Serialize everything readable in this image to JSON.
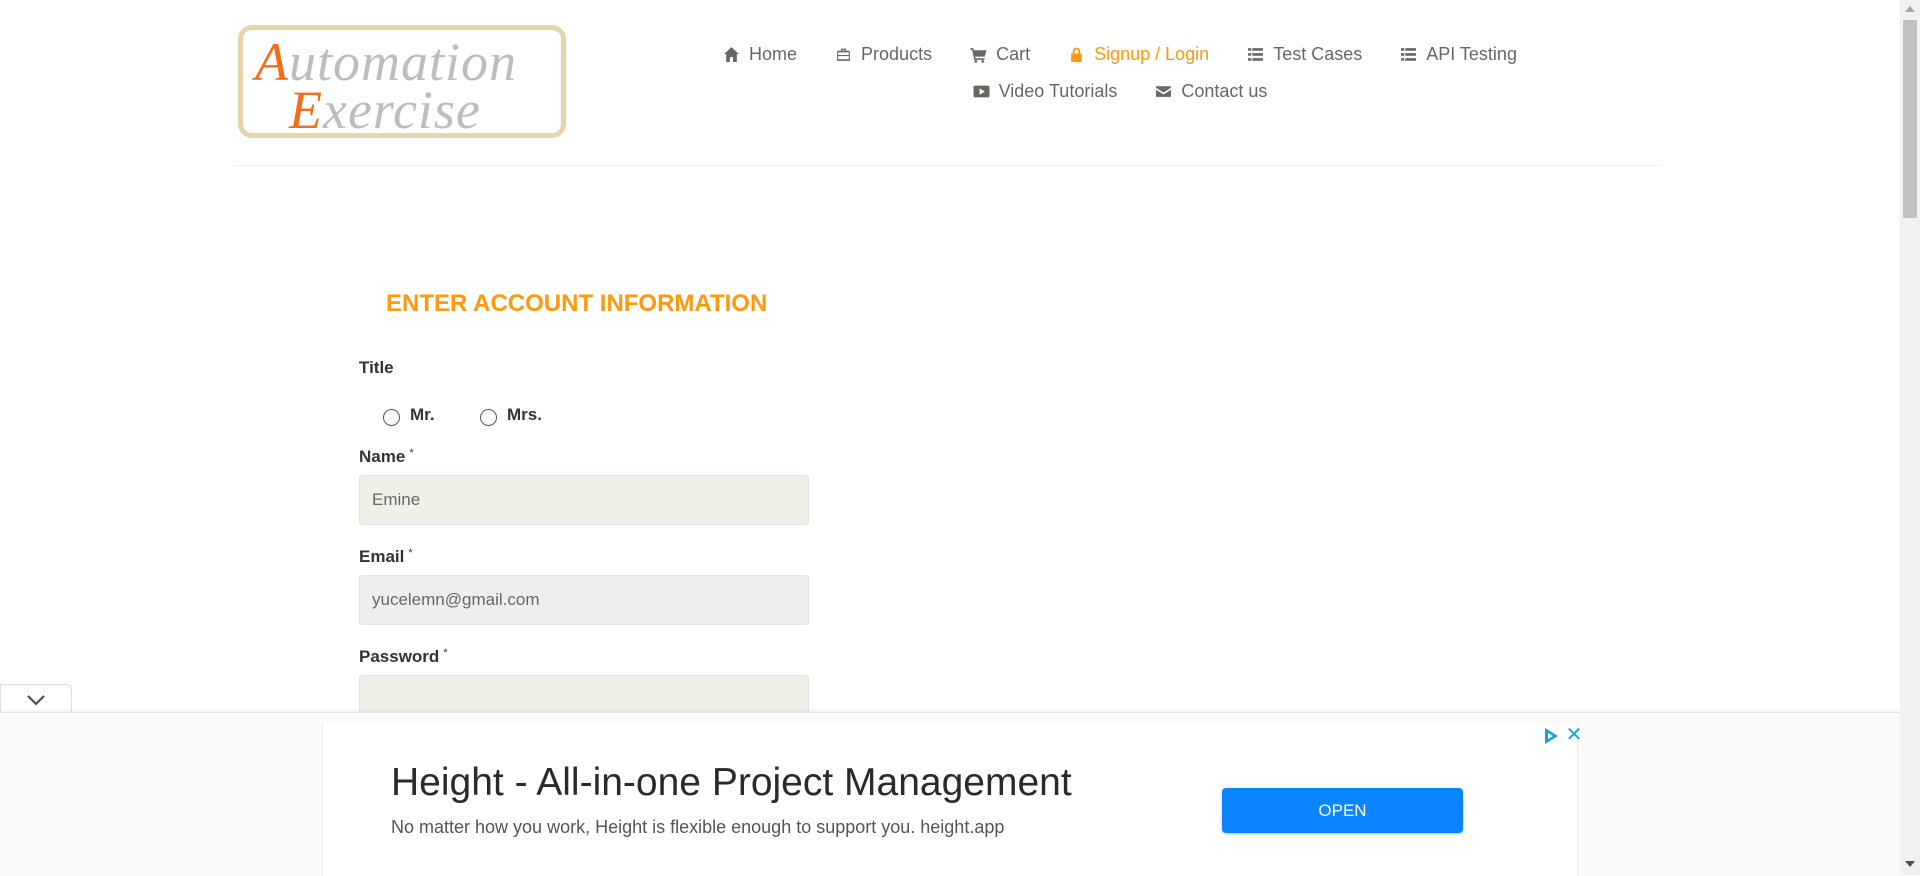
{
  "logo": {
    "line1_cap": "A",
    "line1_rest": "utomation",
    "line2_cap": "E",
    "line2_rest": "xercise"
  },
  "nav": {
    "items": [
      {
        "label": "Home",
        "icon": "home-icon"
      },
      {
        "label": "Products",
        "icon": "briefcase-icon"
      },
      {
        "label": "Cart",
        "icon": "cart-icon"
      },
      {
        "label": "Signup / Login",
        "icon": "lock-icon",
        "active": true
      },
      {
        "label": "Test Cases",
        "icon": "list-icon"
      },
      {
        "label": "API Testing",
        "icon": "list-icon"
      },
      {
        "label": "Video Tutorials",
        "icon": "youtube-play-icon"
      },
      {
        "label": "Contact us",
        "icon": "envelope-icon"
      }
    ]
  },
  "form": {
    "heading": "ENTER ACCOUNT INFORMATION",
    "title_label": "Title",
    "title_options": [
      "Mr.",
      "Mrs."
    ],
    "required_mark": "*",
    "name_label": "Name",
    "name_value": "Emine",
    "email_label": "Email",
    "email_value": "yucelemn@gmail.com",
    "password_label": "Password",
    "password_value": ""
  },
  "ad": {
    "title": "Height - All-in-one Project Management",
    "description": "No matter how you work, Height is flexible enough to support you. height.app",
    "button_label": "OPEN",
    "close_glyph": "✕"
  },
  "colors": {
    "accent": "#fe980f",
    "text": "#696763",
    "ad_button": "#0a84ff"
  }
}
